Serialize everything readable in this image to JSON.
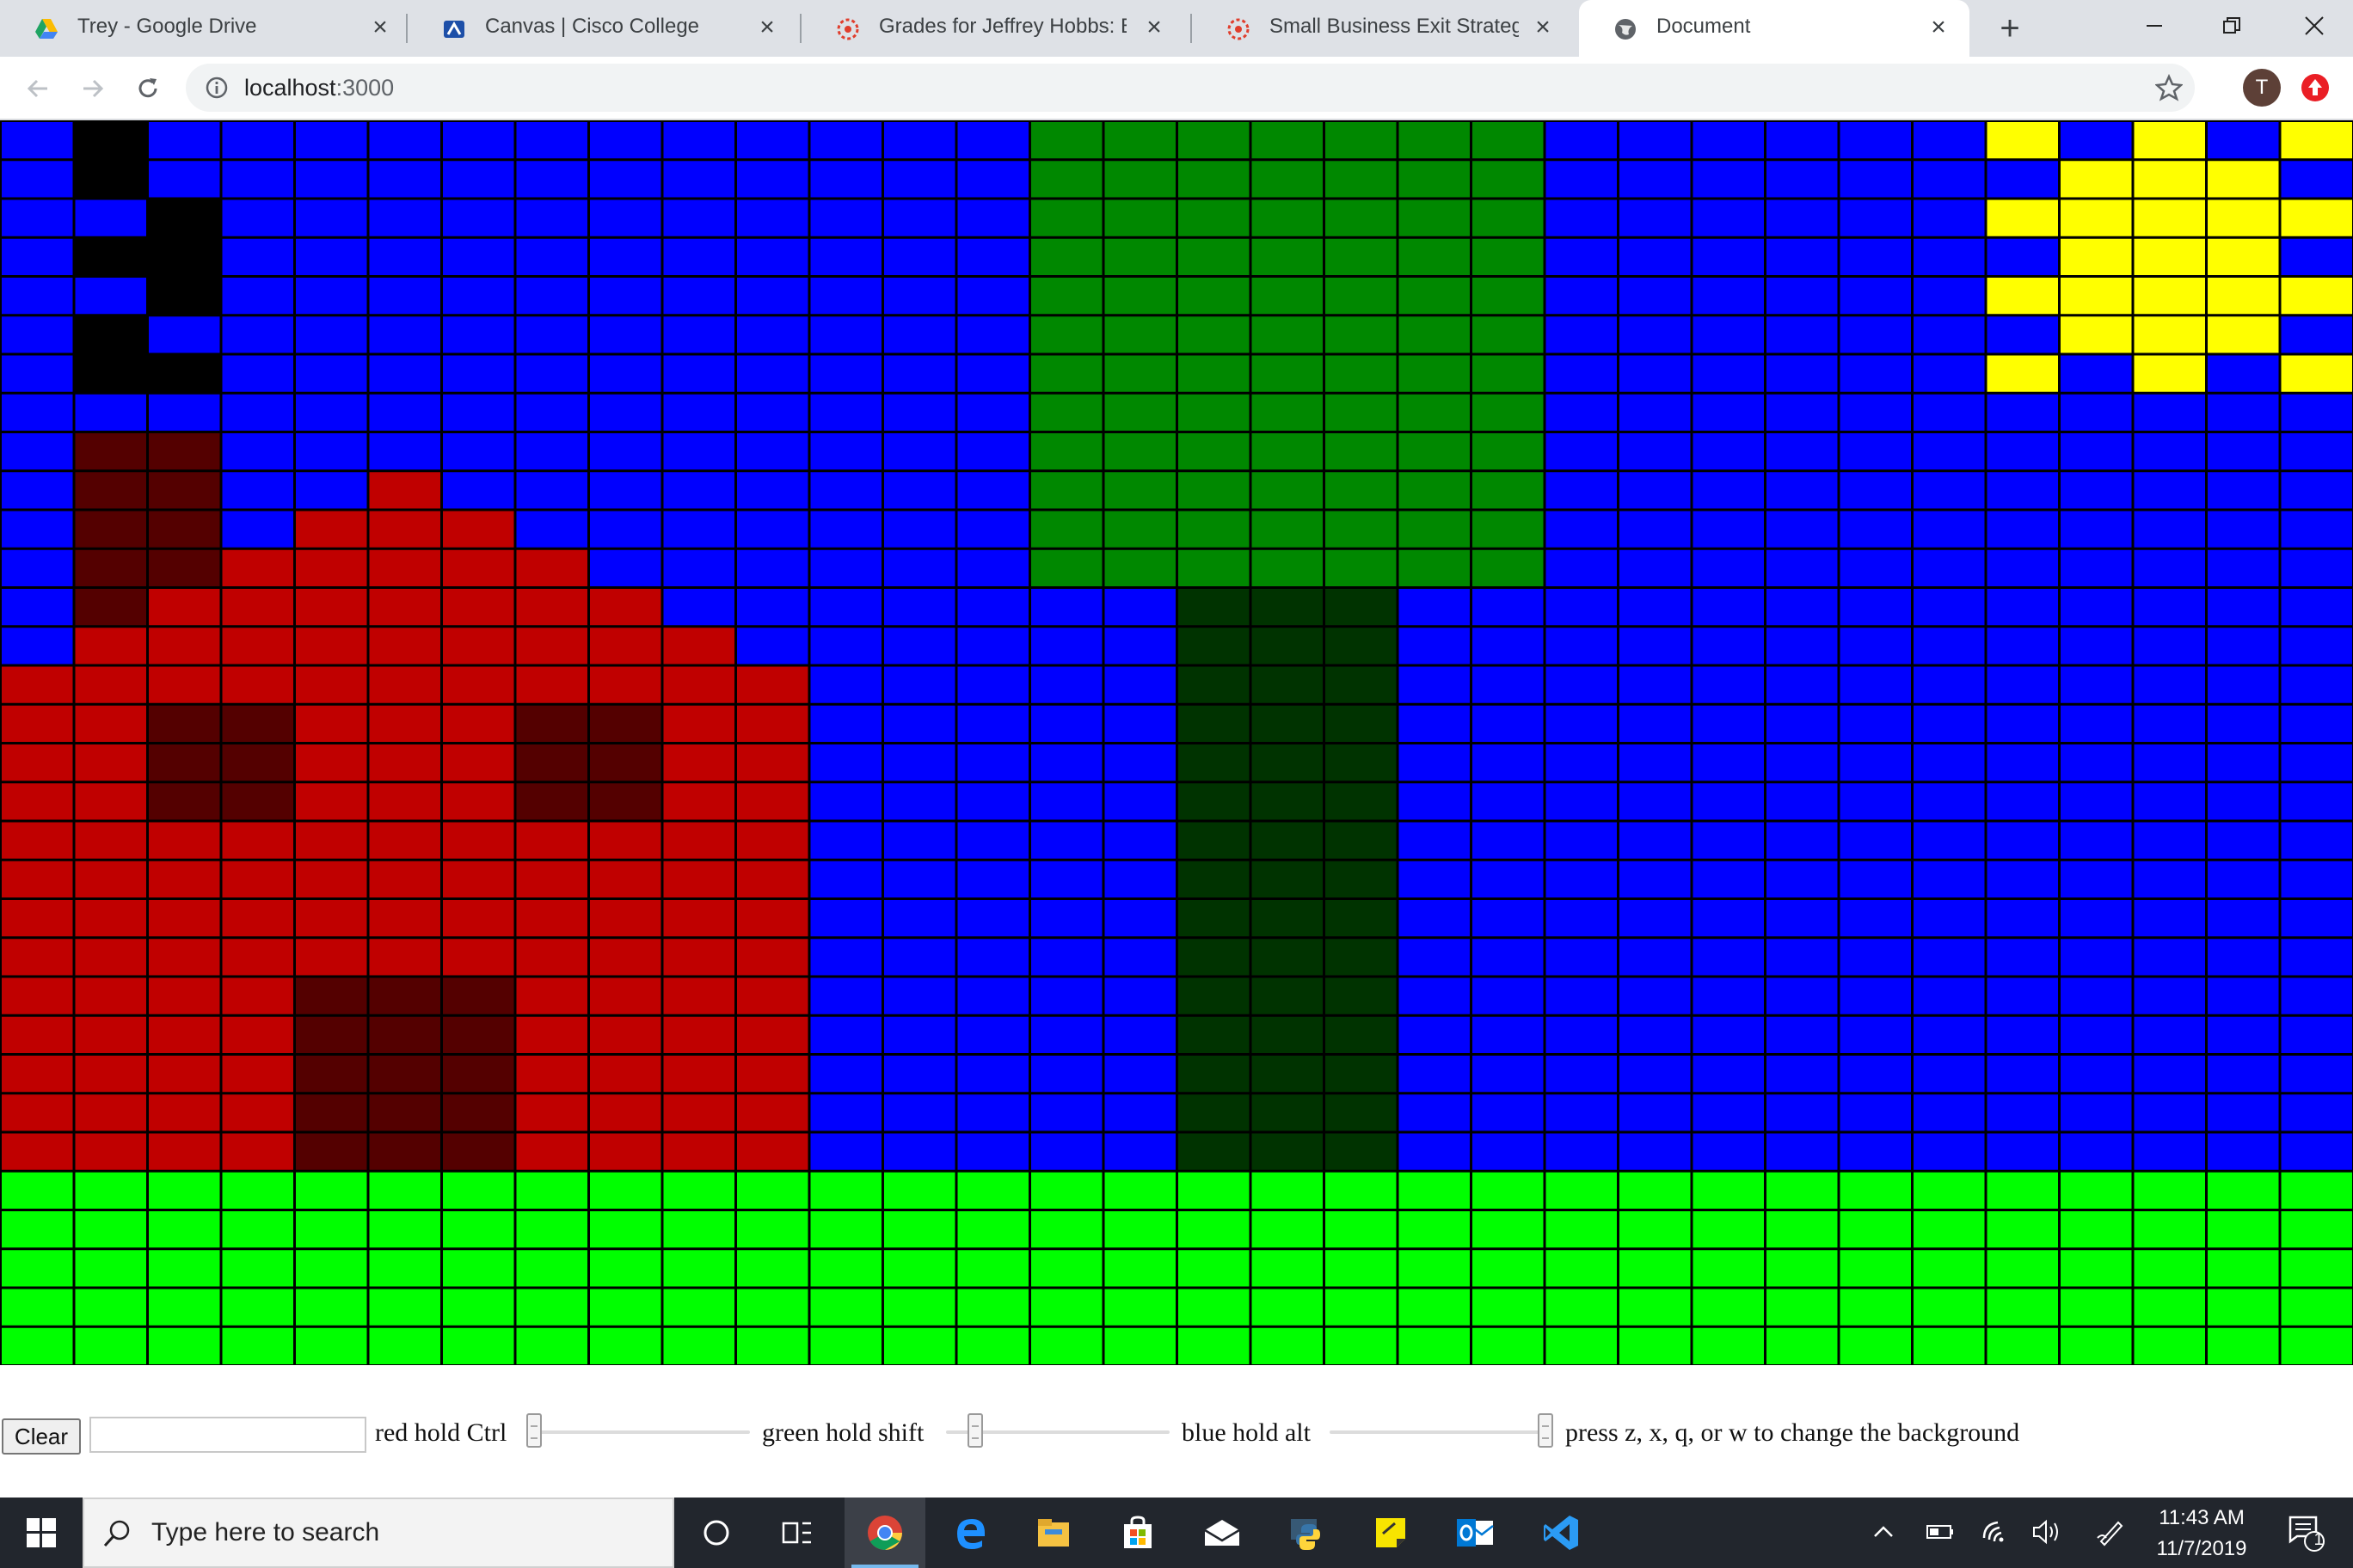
{
  "browser": {
    "tabs": [
      {
        "title": "Trey - Google Drive",
        "icon": "google-drive-icon",
        "active": false
      },
      {
        "title": "Canvas | Cisco College",
        "icon": "canvas-icon",
        "active": false
      },
      {
        "title": "Grades for Jeffrey Hobbs: Busi",
        "icon": "canvas-red-icon",
        "active": false
      },
      {
        "title": "Small Business Exit Strategies N",
        "icon": "canvas-red-icon",
        "active": false
      },
      {
        "title": "Document",
        "icon": "globe-icon",
        "active": true
      }
    ],
    "new_tab_label": "+",
    "url_host": "localhost",
    "url_port": ":3000",
    "profile_initial": "T"
  },
  "app": {
    "clear_label": "Clear",
    "input_value": "",
    "red_label": "red hold Ctrl",
    "green_label": "green hold shift",
    "blue_label": "blue hold alt",
    "instructions": "press z, x, q, or w to change the background",
    "sliders": [
      {
        "name": "red",
        "value": 0,
        "min": 0,
        "max": 255
      },
      {
        "name": "green",
        "value": 26,
        "min": 0,
        "max": 255
      },
      {
        "name": "blue",
        "value": 255,
        "min": 0,
        "max": 255
      }
    ]
  },
  "pixel_grid": {
    "columns": 32,
    "rows": 32,
    "palette": {
      "B": "#0000ff",
      "K": "#000000",
      "M": "#540000",
      "R": "#c00000",
      "G": "#008800",
      "D": "#003300",
      "Y": "#ffff00",
      "L": "#00ff00"
    },
    "cells": [
      "BKBBBBBBBBBBBBGGGGGGGBBBBBBYBYBY",
      "BKBBBBBBBBBBBBGGGGGGGBBBBBBBYYYB",
      "BBKBBBBBBBBBBBGGGGGGGBBBBBBYYYYY",
      "BKKBBBBBBBBBBBGGGGGGGBBBBBBBYYYB",
      "BBKBBBBBBBBBBBGGGGGGGBBBBBBYYYYY",
      "BKBBBBBBBBBBBBGGGGGGGBBBBBBBYYYB",
      "BKKBBBBBBBBBBBGGGGGGGBBBBBBYBYBY",
      "BBBBBBBBBBBBBBGGGGGGGBBBBBBBBBBB",
      "BMMBBBBBBBBBBBGGGGGGGBBBBBBBBBBB",
      "BMMBBRBBBBBBBBGGGGGGGBBBBBBBBBBB",
      "BMMBRRRBBBBBBBGGGGGGGBBBBBBBBBBB",
      "BMMRRRRRBBBBBBGGGGGGGBBBBBBBBBBB",
      "BMRRRRRRRBBBBBBBDDDBBBBBBBBBBBBB",
      "BRRRRRRRRRBBBBBBDDDBBBBBBBBBBBBB",
      "RRRRRRRRRRRBBBBBDDDBBBBBBBBBBBBB",
      "RRMMRRRMMRRBBBBBDDDBBBBBBBBBBBBB",
      "RRMMRRRMMRRBBBBBDDDBBBBBBBBBBBBB",
      "RRMMRRRMMRRBBBBBDDDBBBBBBBBBBBBB",
      "RRRRRRRRRRRBBBBBDDDBBBBBBBBBBBBB",
      "RRRRRRRRRRRBBBBBDDDBBBBBBBBBBBBB",
      "RRRRRRRRRRRBBBBBDDDBBBBBBBBBBBBB",
      "RRRRRRRRRRRBBBBBDDDBBBBBBBBBBBBB",
      "RRRRMMMRRRRBBBBBDDDBBBBBBBBBBBBB",
      "RRRRMMMRRRRBBBBBDDDBBBBBBBBBBBBB",
      "RRRRMMMRRRRBBBBBDDDBBBBBBBBBBBBB",
      "RRRRMMMRRRRBBBBBDDDBBBBBBBBBBBBB",
      "RRRRMMMRRRRBBBBBDDDBBBBBBBBBBBBB",
      "LLLLLLLLLLLLLLLLLLLLLLLLLLLLLLLL",
      "LLLLLLLLLLLLLLLLLLLLLLLLLLLLLLLL",
      "LLLLLLLLLLLLLLLLLLLLLLLLLLLLLLLL",
      "LLLLLLLLLLLLLLLLLLLLLLLLLLLLLLLL",
      "LLLLLLLLLLLLLLLLLLLLLLLLLLLLLLLL"
    ]
  },
  "taskbar": {
    "search_placeholder": "Type here to search",
    "apps": [
      "cortana-icon",
      "task-view-icon",
      "chrome-icon",
      "edge-icon",
      "file-explorer-icon",
      "store-icon",
      "mail-icon",
      "python-icon",
      "sticky-notes-icon",
      "outlook-icon",
      "vscode-icon"
    ],
    "time": "11:43 AM",
    "date": "11/7/2019",
    "notification_count": "1"
  }
}
